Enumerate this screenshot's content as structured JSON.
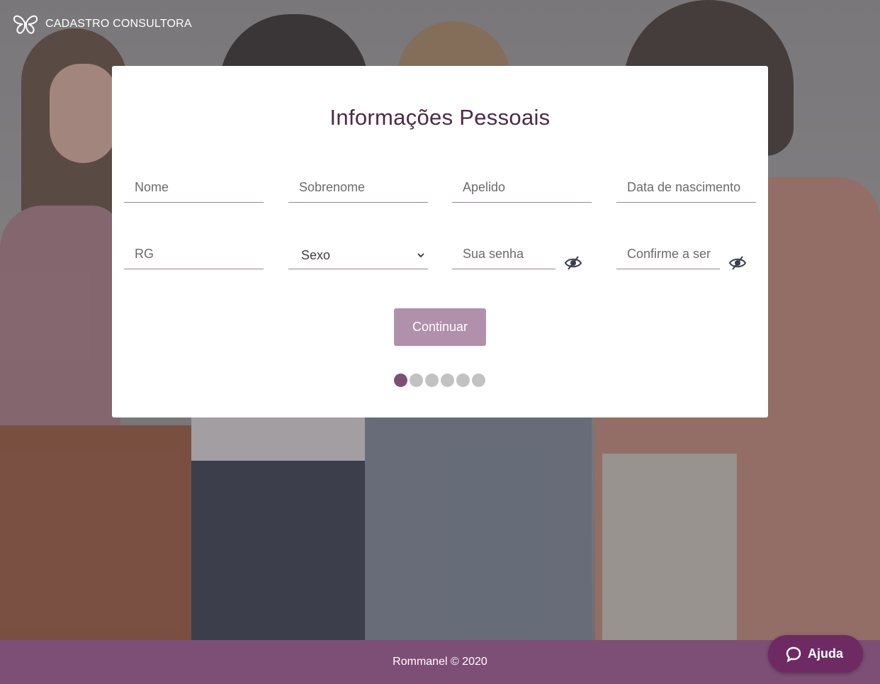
{
  "header": {
    "brand": "CADASTRO CONSULTORA",
    "logo_icon": "butterfly-logo-icon"
  },
  "form": {
    "title": "Informações Pessoais",
    "fields": {
      "nome": "Nome",
      "sobrenome": "Sobrenome",
      "apelido": "Apelido",
      "nascimento": "Data de nascimento",
      "rg": "RG",
      "sexo": "Sexo",
      "senha": "Sua senha",
      "confirme": "Confirme a ser"
    },
    "submit_label": "Continuar",
    "steps": {
      "total": 6,
      "current": 1
    }
  },
  "footer": {
    "text": "Rommanel © 2020"
  },
  "help": {
    "label": "Ajuda"
  },
  "colors": {
    "brand": "#7e4f76",
    "button": "#b090ab",
    "title": "#4d2a46",
    "help": "#6e2a63"
  }
}
